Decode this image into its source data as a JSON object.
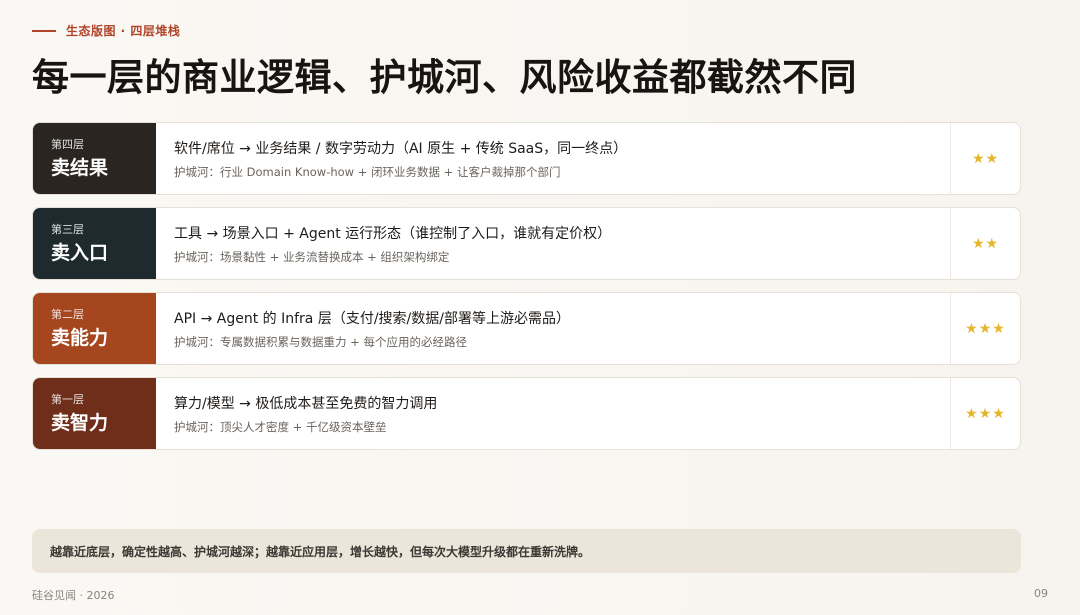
{
  "header": {
    "kicker": "生态版图 · 四层堆栈",
    "title": "每一层的商业逻辑、护城河、风险收益都截然不同"
  },
  "layers": [
    {
      "tier": "第四层",
      "name": "卖结果",
      "headline": "软件/席位 → 业务结果 / 数字劳动力（AI 原生 + 传统 SaaS，同一终点）",
      "moat": "护城河：行业 Domain Know-how + 闭环业务数据 + 让客户裁掉那个部门",
      "rating": 2,
      "stars": "★★"
    },
    {
      "tier": "第三层",
      "name": "卖入口",
      "headline": "工具 → 场景入口 + Agent 运行形态（谁控制了入口，谁就有定价权）",
      "moat": "护城河：场景黏性 + 业务流替换成本 + 组织架构绑定",
      "rating": 2,
      "stars": "★★"
    },
    {
      "tier": "第二层",
      "name": "卖能力",
      "headline": "API → Agent 的 Infra 层（支付/搜索/数据/部署等上游必需品）",
      "moat": "护城河：专属数据积累与数据重力 + 每个应用的必经路径",
      "rating": 3,
      "stars": "★★★"
    },
    {
      "tier": "第一层",
      "name": "卖智力",
      "headline": "算力/模型 → 极低成本甚至免费的智力调用",
      "moat": "护城河：顶尖人才密度 + 千亿级资本壁垒",
      "rating": 3,
      "stars": "★★★"
    }
  ],
  "summary": "越靠近底层，确定性越高、护城河越深；越靠近应用层，增长越快，但每次大模型升级都在重新洗牌。",
  "footer": {
    "source": "硅谷见闻 · 2026",
    "page": "09"
  },
  "colors": {
    "accent": "#b0452a",
    "layer4": "#2a2521",
    "layer3": "#1e2a2d",
    "layer2": "#a5461f",
    "layer1": "#6e2e19",
    "star": "#e5b52c"
  }
}
